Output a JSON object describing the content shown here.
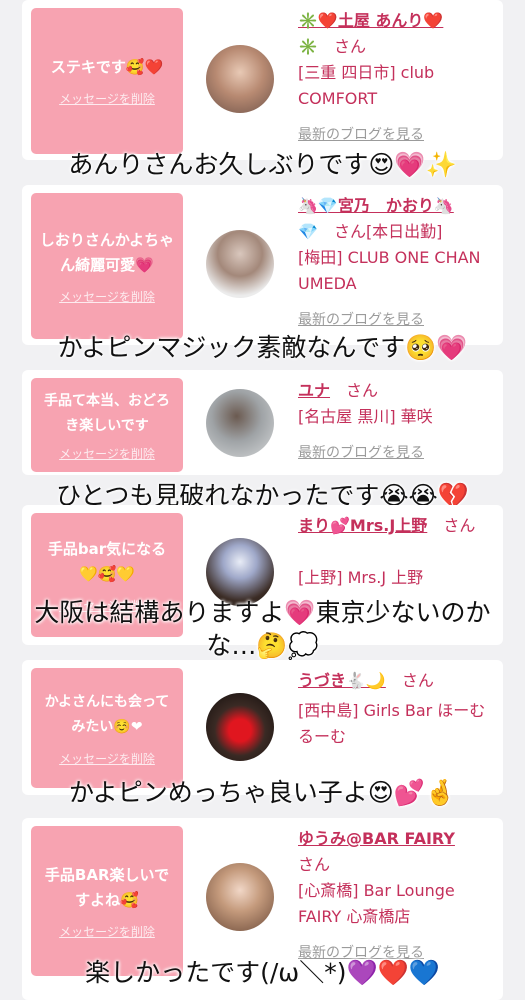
{
  "cards": [
    {
      "message": "ステキです🥰❤️",
      "delete_label": "メッセージを削除",
      "name_line1": "✳️❤️土屋 あんり❤️",
      "name_line2": "✳️",
      "san": "さん",
      "shop": "[三重 四日市] club COMFORT",
      "blog": "最新のブログを見る",
      "caption": "あんりさんお久しぶりです😍💗✨"
    },
    {
      "message": "しおりさんかよちゃん綺麗可愛💗",
      "delete_label": "メッセージを削除",
      "name_line1": "🦄💎宮乃　かおり🦄",
      "name_line2": "💎",
      "san": "さん[本日出勤]",
      "shop": "[梅田] CLUB ONE CHAN UMEDA",
      "blog": "最新のブログを見る",
      "caption": "かよピンマジック素敵なんです🥺💗"
    },
    {
      "message": "手品て本当、おどろき楽しいです",
      "delete_label": "メッセージを削除",
      "name_line1": "ユナ",
      "san": "さん",
      "shop": "[名古屋 黒川] 華咲",
      "blog": "最新のブログを見る",
      "caption": "ひとつも見破れなかったです😭😭💔"
    },
    {
      "message": "手品bar気になる💛🥰💛",
      "delete_label": "メッセージを削除",
      "name_line1": "まり💕Mrs.J上野",
      "san": "さん",
      "shop": "[上野] Mrs.J 上野",
      "blog": "",
      "caption": "大阪は結構ありますよ💗東京少ないのかな…🤔💭"
    },
    {
      "message": "かよさんにも会ってみたい☺️❤",
      "delete_label": "メッセージを削除",
      "name_line1": "うづき🐇🌙",
      "san": "さん",
      "shop": "[西中島] Girls Bar ほーむるーむ",
      "blog": "",
      "caption": "かよピンめっちゃ良い子よ😍💕🤞"
    },
    {
      "message": "手品BAR楽しいですよね🥰",
      "delete_label": "メッセージを削除",
      "name_line1": "ゆうみ@BAR FAIRY",
      "san": "さん",
      "shop": "[心斎橋] Bar Lounge FAIRY 心斎橋店",
      "blog": "最新のブログを見る",
      "caption": "楽しかったです(/ω＼*)💜❤️💙"
    }
  ],
  "colors": {
    "bubble": "#f7a3b1",
    "accent": "#c4305b",
    "muted": "#9b9b9b",
    "background": "#f1f1f3"
  }
}
